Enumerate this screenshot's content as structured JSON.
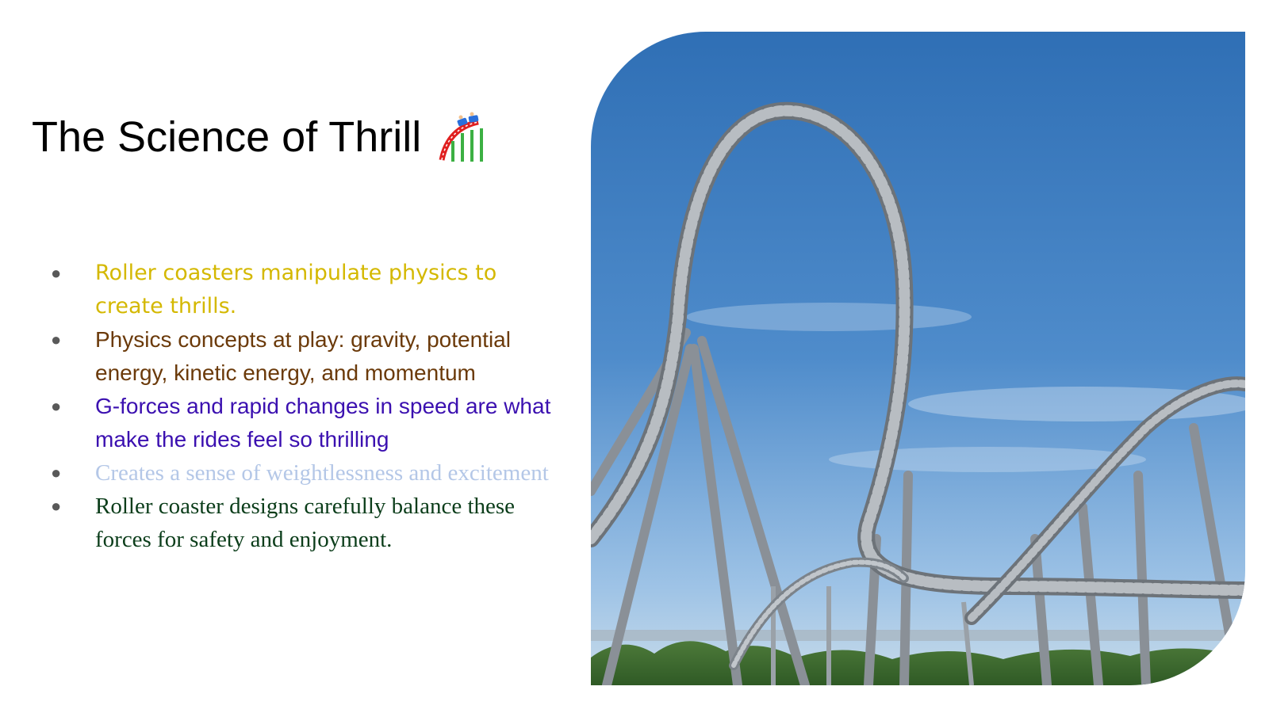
{
  "slide": {
    "title": "The Science of Thrill",
    "title_icon": "roller-coaster-icon",
    "bullets": [
      {
        "text": "Roller coasters manipulate physics to create thrills.",
        "color": "#d4b800"
      },
      {
        "text": "Physics concepts at play: gravity, potential energy, kinetic energy, and momentum",
        "color": "#6b3a0a"
      },
      {
        "text": "G-forces and rapid changes in speed are what make the rides feel so thrilling",
        "color": "#3b10b0"
      },
      {
        "text": "Creates a sense of weightlessness and excitement",
        "color": "#b4c7e7"
      },
      {
        "text": "Roller coaster designs carefully balance these forces for safety and enjoyment.",
        "color": "#0b3d1a"
      }
    ],
    "bullet_glyph": "●",
    "image": {
      "subject": "roller-coaster-loop-photo",
      "sky_color": "#4a86c5"
    }
  }
}
